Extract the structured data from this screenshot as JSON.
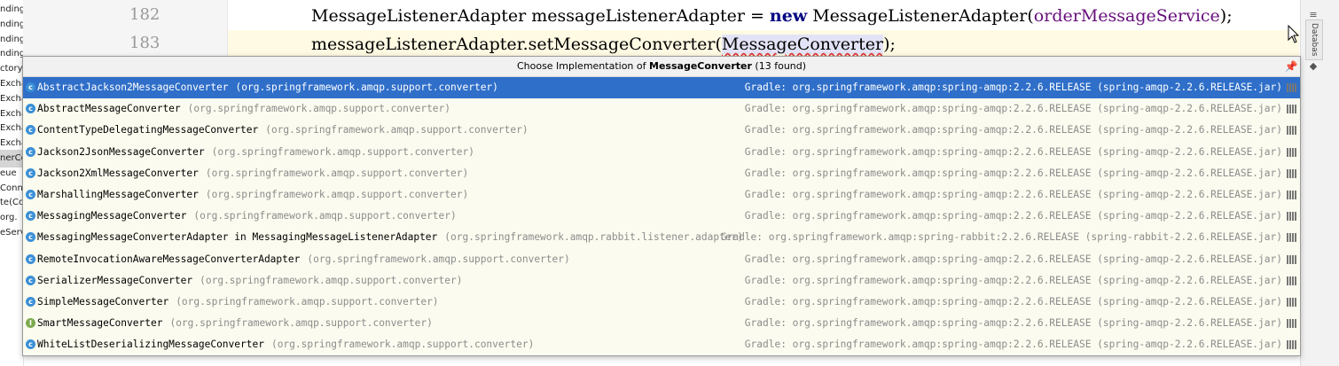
{
  "left_tree": {
    "items": [
      "nding",
      "nding",
      "nding",
      "nding",
      "ctory(",
      "Excha",
      "Excha",
      "Excha",
      "Excha",
      "Excha",
      "nerCo",
      "eue",
      "Conne",
      "te(Co",
      "org.",
      "eServ"
    ],
    "selected_index": 10
  },
  "editor": {
    "lines": [
      {
        "number": "182",
        "seg1": "MessageListenerAdapter messageListenerAdapter = ",
        "kw": "new",
        "seg2": " MessageListenerAdapter(",
        "field": "orderMessageService",
        "seg3": ");"
      },
      {
        "number": "183",
        "seg1": "messageListenerAdapter.setMessageConverter(",
        "highlight": "MessageConverter",
        "seg2": ");"
      }
    ]
  },
  "right_strip": {
    "tab_label": "Databas"
  },
  "popup": {
    "title_prefix": "Choose Implementation of ",
    "title_class": "MessageConverter",
    "title_suffix": " (13 found)",
    "rows": [
      {
        "name": "AbstractJackson2MessageConverter",
        "pkg": "(org.springframework.amqp.support.converter)",
        "lib": "Gradle: org.springframework.amqp:spring-amqp:2.2.6.RELEASE (spring-amqp-2.2.6.RELEASE.jar)",
        "icon": "class"
      },
      {
        "name": "AbstractMessageConverter",
        "pkg": "(org.springframework.amqp.support.converter)",
        "lib": "Gradle: org.springframework.amqp:spring-amqp:2.2.6.RELEASE (spring-amqp-2.2.6.RELEASE.jar)",
        "icon": "class"
      },
      {
        "name": "ContentTypeDelegatingMessageConverter",
        "pkg": "(org.springframework.amqp.support.converter)",
        "lib": "Gradle: org.springframework.amqp:spring-amqp:2.2.6.RELEASE (spring-amqp-2.2.6.RELEASE.jar)",
        "icon": "class"
      },
      {
        "name": "Jackson2JsonMessageConverter",
        "pkg": "(org.springframework.amqp.support.converter)",
        "lib": "Gradle: org.springframework.amqp:spring-amqp:2.2.6.RELEASE (spring-amqp-2.2.6.RELEASE.jar)",
        "icon": "class"
      },
      {
        "name": "Jackson2XmlMessageConverter",
        "pkg": "(org.springframework.amqp.support.converter)",
        "lib": "Gradle: org.springframework.amqp:spring-amqp:2.2.6.RELEASE (spring-amqp-2.2.6.RELEASE.jar)",
        "icon": "class"
      },
      {
        "name": "MarshallingMessageConverter",
        "pkg": "(org.springframework.amqp.support.converter)",
        "lib": "Gradle: org.springframework.amqp:spring-amqp:2.2.6.RELEASE (spring-amqp-2.2.6.RELEASE.jar)",
        "icon": "class"
      },
      {
        "name": "MessagingMessageConverter",
        "pkg": "(org.springframework.amqp.support.converter)",
        "lib": "Gradle: org.springframework.amqp:spring-amqp:2.2.6.RELEASE (spring-amqp-2.2.6.RELEASE.jar)",
        "icon": "class"
      },
      {
        "name": "MessagingMessageConverterAdapter in MessagingMessageListenerAdapter",
        "pkg": "(org.springframework.amqp.rabbit.listener.adapter)",
        "lib": "Gradle: org.springframework.amqp:spring-rabbit:2.2.6.RELEASE (spring-rabbit-2.2.6.RELEASE.jar)",
        "icon": "class"
      },
      {
        "name": "RemoteInvocationAwareMessageConverterAdapter",
        "pkg": "(org.springframework.amqp.support.converter)",
        "lib": "Gradle: org.springframework.amqp:spring-amqp:2.2.6.RELEASE (spring-amqp-2.2.6.RELEASE.jar)",
        "icon": "class"
      },
      {
        "name": "SerializerMessageConverter",
        "pkg": "(org.springframework.amqp.support.converter)",
        "lib": "Gradle: org.springframework.amqp:spring-amqp:2.2.6.RELEASE (spring-amqp-2.2.6.RELEASE.jar)",
        "icon": "class"
      },
      {
        "name": "SimpleMessageConverter",
        "pkg": "(org.springframework.amqp.support.converter)",
        "lib": "Gradle: org.springframework.amqp:spring-amqp:2.2.6.RELEASE (spring-amqp-2.2.6.RELEASE.jar)",
        "icon": "class"
      },
      {
        "name": "SmartMessageConverter",
        "pkg": "(org.springframework.amqp.support.converter)",
        "lib": "Gradle: org.springframework.amqp:spring-amqp:2.2.6.RELEASE (spring-amqp-2.2.6.RELEASE.jar)",
        "icon": "interface"
      },
      {
        "name": "WhiteListDeserializingMessageConverter",
        "pkg": "(org.springframework.amqp.support.converter)",
        "lib": "Gradle: org.springframework.amqp:spring-amqp:2.2.6.RELEASE (spring-amqp-2.2.6.RELEASE.jar)",
        "icon": "class"
      }
    ],
    "selected_index": 0
  },
  "colors": {
    "selection": "#2f6fc9",
    "popup_bg": "#fbfbef",
    "keyword": "#000080",
    "field": "#660e7a",
    "current_line": "#fffae3"
  }
}
